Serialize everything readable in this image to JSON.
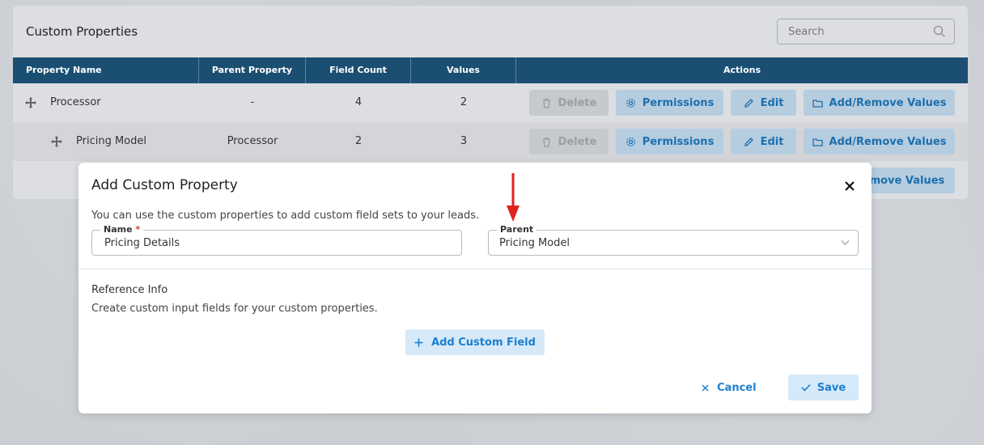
{
  "panel": {
    "title": "Custom Properties",
    "search_placeholder": "Search"
  },
  "table": {
    "columns": [
      "Property Name",
      "Parent Property",
      "Field Count",
      "Values",
      "Actions"
    ],
    "rows": [
      {
        "name": "Processor",
        "parent": "-",
        "field_count": "4",
        "values": "2"
      },
      {
        "name": "Pricing Model",
        "parent": "Processor",
        "field_count": "2",
        "values": "3"
      },
      {
        "name": "",
        "parent": "",
        "field_count": "",
        "values": ""
      }
    ],
    "actions": {
      "delete": "Delete",
      "permissions": "Permissions",
      "edit": "Edit",
      "add_remove": "Add/Remove Values",
      "partial_add_remove": "emove Values"
    }
  },
  "modal": {
    "title": "Add Custom Property",
    "description": "You can use the custom properties to add custom field sets to your leads.",
    "name_label": "Name",
    "name_required": "*",
    "name_value": "Pricing Details",
    "parent_label": "Parent",
    "parent_value": "Pricing Model",
    "reference_title": "Reference Info",
    "reference_desc": "Create custom input fields for your custom properties.",
    "add_field_button": "Add Custom Field",
    "cancel_button": "Cancel",
    "save_button": "Save"
  },
  "colors": {
    "header_bg": "#1b4f72",
    "accent": "#1d7fd0",
    "annotation_arrow": "#e0211d"
  }
}
